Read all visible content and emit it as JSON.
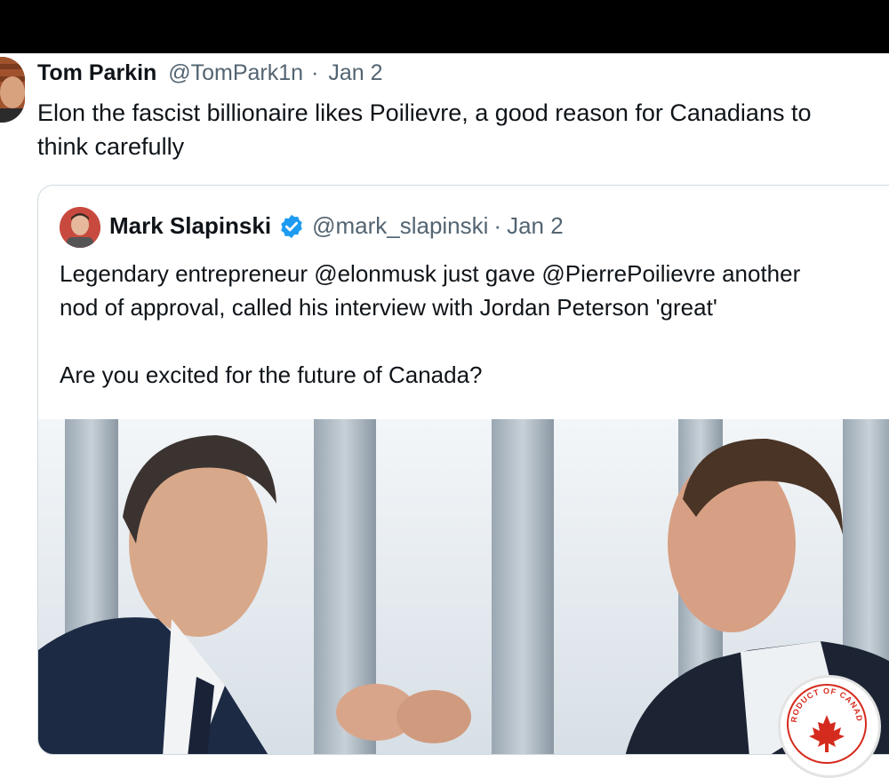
{
  "tweet": {
    "author_name": "Tom Parkin",
    "handle": "@TomPark1n",
    "separator": "·",
    "date": "Jan 2",
    "text_line1": "Elon the fascist billionaire likes Poilievre, a good reason for Canadians to",
    "text_line2": "think carefully"
  },
  "quote": {
    "author_name": "Mark Slapinski",
    "verified_icon": "verified-badge-icon",
    "handle": "@mark_slapinski",
    "separator": "·",
    "date": "Jan 2",
    "line1": "Legendary entrepreneur @elonmusk just gave @PierrePoilievre another",
    "line2": "nod of approval, called his interview with Jordan Peterson 'great'",
    "line3": "Are you excited for the future of Canada?",
    "image_alt_icon": "photo-two-men-fist-bump"
  },
  "watermark": {
    "text": "PRODUCT OF CANADA",
    "icon": "maple-leaf-icon",
    "color": "#d52b1e"
  },
  "colors": {
    "text_primary": "#0f1419",
    "text_secondary": "#536471",
    "verified": "#1d9bf0",
    "border": "#cfd9de"
  }
}
